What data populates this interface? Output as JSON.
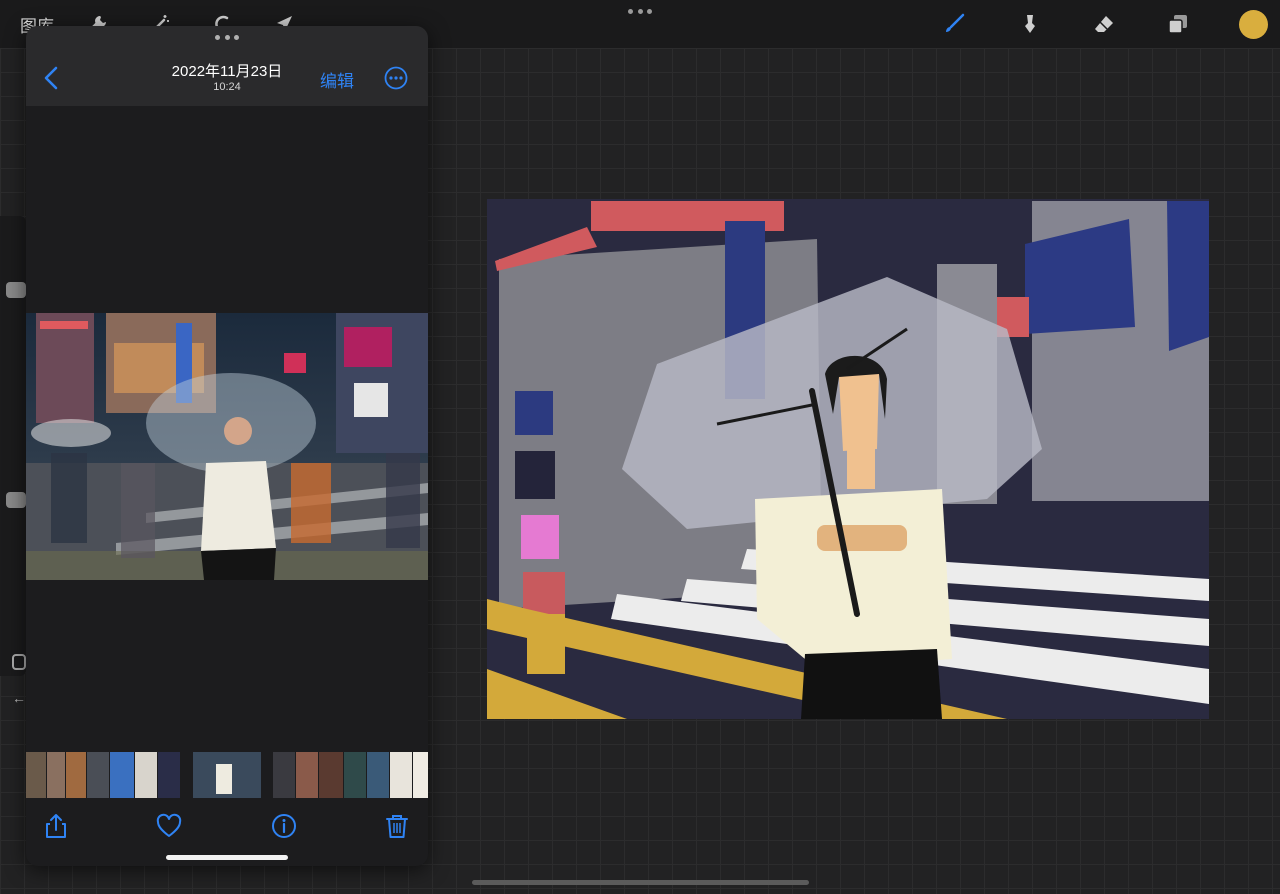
{
  "topbar": {
    "gallery_label": "图库",
    "icons": [
      "wrench-icon",
      "magic-wand-icon",
      "selection-icon",
      "transform-arrow-icon"
    ],
    "right_tools": [
      "brush-icon",
      "smudge-icon",
      "eraser-icon",
      "layers-icon"
    ],
    "active_color": "#d9ae3e",
    "accent_color": "#2f83f4"
  },
  "photos_panel": {
    "date": "2022年11月23日",
    "time": "10:24",
    "edit_label": "编辑",
    "toolbar_icons": [
      "share-icon",
      "heart-icon",
      "info-icon",
      "trash-icon"
    ]
  }
}
